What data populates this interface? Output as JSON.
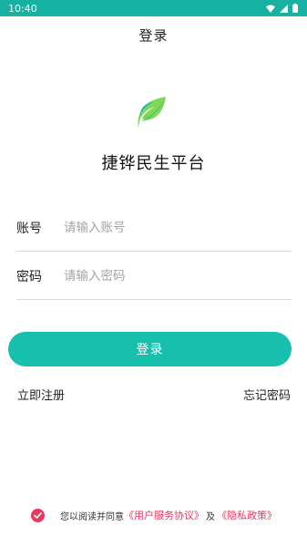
{
  "status_bar": {
    "time": "10:40",
    "background_color": "#16b1a1",
    "icons": [
      "wifi-icon",
      "signal-icon",
      "battery-icon"
    ]
  },
  "header": {
    "title": "登录"
  },
  "app": {
    "logo_icon": "leaf-logo-icon",
    "name": "捷铧民生平台"
  },
  "form": {
    "account": {
      "label": "账号",
      "placeholder": "请输入账号",
      "value": ""
    },
    "password": {
      "label": "密码",
      "placeholder": "请输入密码",
      "value": ""
    },
    "login_button": "登录",
    "accent_color": "#16c0ad"
  },
  "links": {
    "register": "立即注册",
    "forgot_password": "忘记密码"
  },
  "agreement": {
    "checked": true,
    "prefix": "您以阅读并同意",
    "user_agreement": "《用户服务协议》",
    "separator": "及",
    "privacy_policy": "《隐私政策》",
    "highlight_color": "#e8385d"
  }
}
